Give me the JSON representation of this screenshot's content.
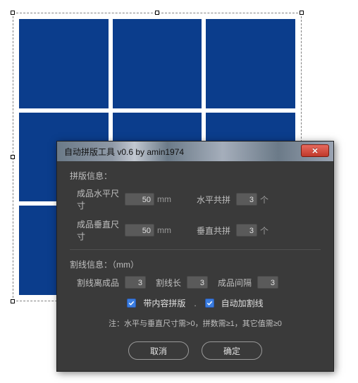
{
  "dialog": {
    "title": "自动拼版工具 v0.6   by amin1974",
    "sections": {
      "layout_title": "拼版信息：",
      "size_h_label": "成品水平尺寸",
      "size_h_value": "50",
      "size_v_label": "成品垂直尺寸",
      "size_v_value": "50",
      "unit_mm": "mm",
      "h_count_label": "水平共拼",
      "h_count_value": "3",
      "v_count_label": "垂直共拼",
      "v_count_value": "3",
      "unit_ge": "个",
      "cut_title": "割线信息：（mm）",
      "cut_offset_label": "割线离成品",
      "cut_offset_value": "3",
      "cut_len_label": "割线长",
      "cut_len_value": "3",
      "gap_label": "成品间隔",
      "gap_value": "3",
      "chk_content_label": "带内容拼版",
      "chk_cutline_label": "自动加割线",
      "note": "注：水平与垂直尺寸需>0，拼数需≥1，其它值需≥0",
      "cancel": "取消",
      "ok": "确定"
    }
  }
}
